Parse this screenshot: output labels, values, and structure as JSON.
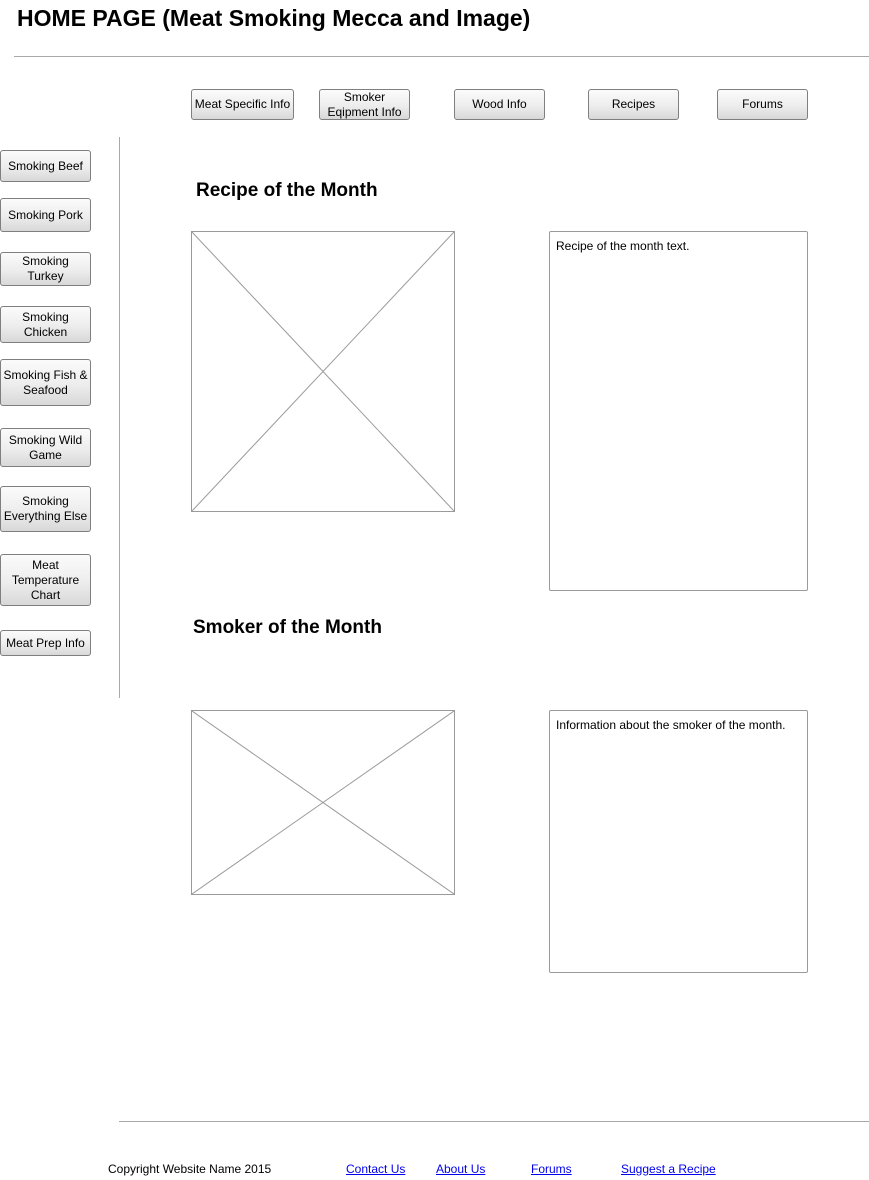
{
  "header": {
    "title": "HOME PAGE (Meat Smoking Mecca and Image)"
  },
  "top_nav": {
    "items": [
      {
        "label": "Meat Specific Info"
      },
      {
        "label": "Smoker Eqipment Info"
      },
      {
        "label": "Wood Info"
      },
      {
        "label": "Recipes"
      },
      {
        "label": "Forums"
      }
    ]
  },
  "sidebar": {
    "items": [
      {
        "label": "Smoking Beef"
      },
      {
        "label": "Smoking Pork"
      },
      {
        "label": "Smoking Turkey"
      },
      {
        "label": "Smoking Chicken"
      },
      {
        "label": "Smoking Fish & Seafood"
      },
      {
        "label": "Smoking Wild Game"
      },
      {
        "label": "Smoking Everything Else"
      },
      {
        "label": "Meat Temperature Chart"
      },
      {
        "label": "Meat Prep Info"
      }
    ]
  },
  "recipe_section": {
    "title": "Recipe of the Month",
    "text": "Recipe of the month text."
  },
  "smoker_section": {
    "title": "Smoker of the Month",
    "text": "Information about the smoker of the month."
  },
  "footer": {
    "copyright": "Copyright Website Name 2015",
    "links": [
      {
        "label": "Contact Us"
      },
      {
        "label": "About Us"
      },
      {
        "label": "Forums"
      },
      {
        "label": "Suggest a Recipe"
      }
    ]
  },
  "colors": {
    "link": "#0000ee",
    "border": "#9a9a9a",
    "divider": "#a8a8a8"
  }
}
